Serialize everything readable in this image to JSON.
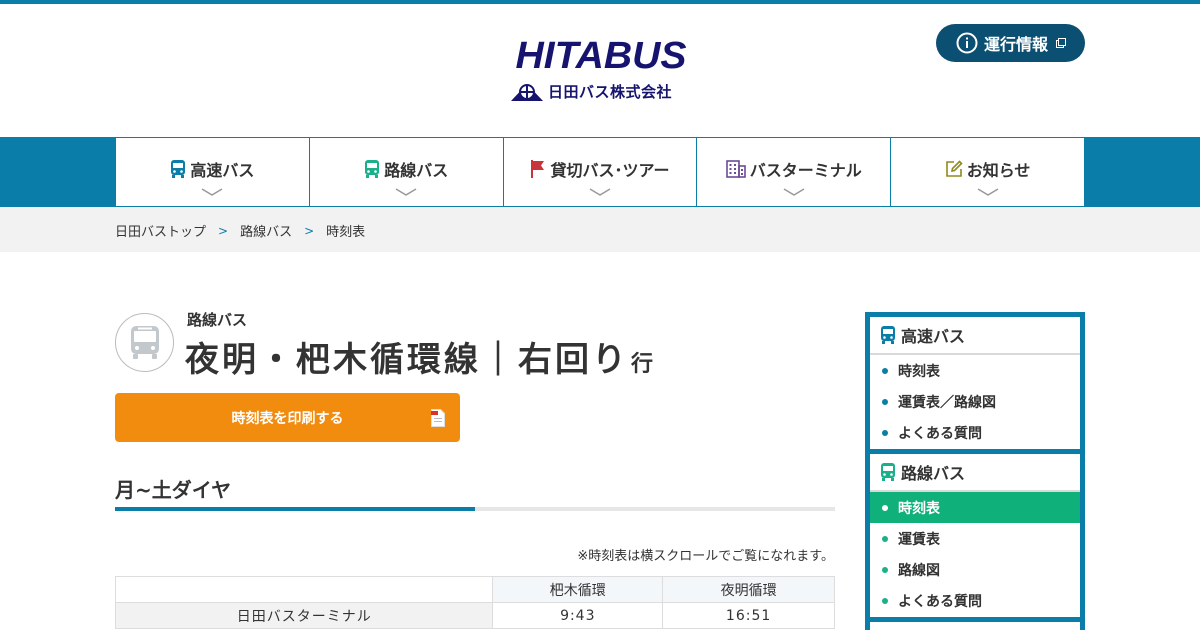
{
  "header": {
    "logo_text": "HITABUS",
    "logo_subtitle": "日田バス株式会社",
    "info_button_label": "運行情報"
  },
  "nav": {
    "items": [
      {
        "label": "高速バス",
        "icon": "bus-icon",
        "color": "#0a7ea8"
      },
      {
        "label": "路線バス",
        "icon": "bus-icon",
        "color": "#1ab08a"
      },
      {
        "label": "貸切バス･ツアー",
        "icon": "flag-icon",
        "color": "#c9343c"
      },
      {
        "label": "バスターミナル",
        "icon": "building-icon",
        "color": "#6b4a96"
      },
      {
        "label": "お知らせ",
        "icon": "edit-icon",
        "color": "#8f8a1c"
      }
    ]
  },
  "breadcrumb": {
    "items": [
      "日田バストップ",
      "路線バス",
      "時刻表"
    ],
    "separator": ">"
  },
  "route": {
    "kind": "路線バス",
    "title": "夜明・杷木循環線｜右回り",
    "suffix": "行"
  },
  "print_button_label": "時刻表を印刷する",
  "schedule": {
    "section_title": "月~土ダイヤ",
    "scroll_note": "※時刻表は横スクロールでご覧になれます。",
    "columns": [
      "",
      "杷木循環",
      "夜明循環"
    ],
    "rows": [
      {
        "stop": "日田バスターミナル",
        "times": [
          "9:43",
          "16:51"
        ]
      }
    ]
  },
  "sidebar": {
    "sections": [
      {
        "title": "高速バス",
        "links": [
          "時刻表",
          "運賃表／路線図",
          "よくある質問"
        ]
      },
      {
        "title": "路線バス",
        "links": [
          "時刻表",
          "運賃表",
          "路線図",
          "よくある質問"
        ],
        "active_index": 0
      }
    ]
  },
  "colors": {
    "brand_blue": "#0a7ea8",
    "navy": "#16146e",
    "orange": "#f28c0f",
    "green": "#1ab08a"
  }
}
